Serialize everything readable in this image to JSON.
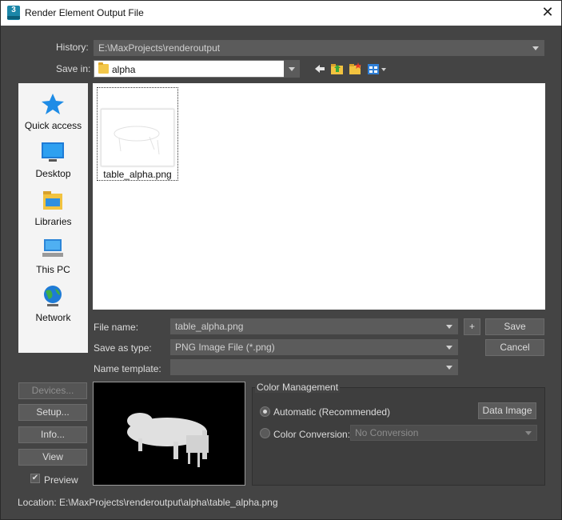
{
  "window": {
    "title": "Render Element Output File"
  },
  "history": {
    "label": "History:",
    "value": "E:\\MaxProjects\\renderoutput"
  },
  "save_in": {
    "label": "Save in:",
    "value": "alpha"
  },
  "places": [
    {
      "label": "Quick access",
      "icon": "quick-access-star-icon"
    },
    {
      "label": "Desktop",
      "icon": "desktop-icon"
    },
    {
      "label": "Libraries",
      "icon": "libraries-icon"
    },
    {
      "label": "This PC",
      "icon": "this-pc-icon"
    },
    {
      "label": "Network",
      "icon": "network-icon"
    }
  ],
  "files": [
    {
      "name": "table_alpha.png"
    }
  ],
  "file_name": {
    "label": "File name:",
    "value": "table_alpha.png"
  },
  "save_as_type": {
    "label": "Save as type:",
    "value": "PNG Image File (*.png)"
  },
  "name_template": {
    "label": "Name template:",
    "value": ""
  },
  "buttons": {
    "plus": "+",
    "save": "Save",
    "cancel": "Cancel",
    "devices": "Devices...",
    "setup": "Setup...",
    "info": "Info...",
    "view": "View"
  },
  "preview": {
    "label": "Preview",
    "checked": true
  },
  "color_management": {
    "title": "Color Management",
    "automatic_label": "Automatic (Recommended)",
    "conversion_label": "Color Conversion:",
    "conversion_value": "No Conversion",
    "data_image_button": "Data Image"
  },
  "location": {
    "label": "Location:",
    "value": "E:\\MaxProjects\\renderoutput\\alpha\\table_alpha.png"
  },
  "colors": {
    "background": "#444444",
    "field": "#5b5b5b",
    "list": "#ffffff"
  }
}
